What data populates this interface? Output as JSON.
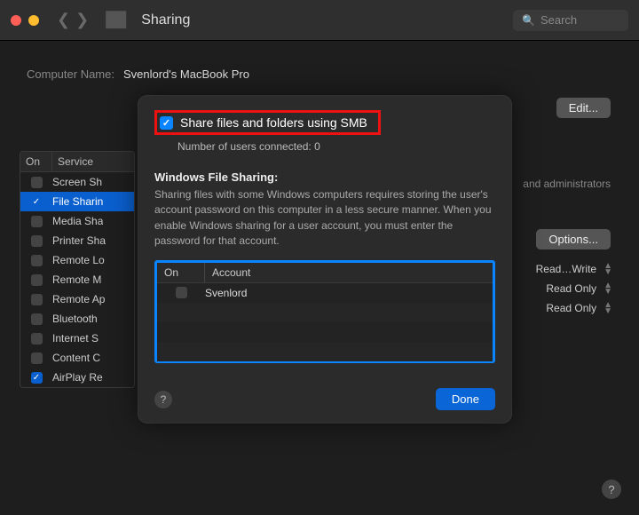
{
  "window": {
    "title": "Sharing",
    "search_placeholder": "Search"
  },
  "main": {
    "computer_name_label": "Computer Name:",
    "computer_name": "Svenlord's MacBook Pro",
    "edit_label": "Edit...",
    "options_label": "Options...",
    "admins_hint": "and administrators"
  },
  "services": {
    "header_on": "On",
    "header_service": "Service",
    "items": [
      {
        "on": false,
        "label": "Screen Sh"
      },
      {
        "on": true,
        "label": "File Sharin"
      },
      {
        "on": false,
        "label": "Media Sha"
      },
      {
        "on": false,
        "label": "Printer Sha"
      },
      {
        "on": false,
        "label": "Remote Lo"
      },
      {
        "on": false,
        "label": "Remote M"
      },
      {
        "on": false,
        "label": "Remote Ap"
      },
      {
        "on": false,
        "label": "Bluetooth"
      },
      {
        "on": false,
        "label": "Internet S"
      },
      {
        "on": false,
        "label": "Content C"
      },
      {
        "on": true,
        "label": "AirPlay Re"
      }
    ]
  },
  "permissions": [
    "Read…Write",
    "Read Only",
    "Read Only"
  ],
  "sheet": {
    "smb_label": "Share files and folders using SMB",
    "connected_text": "Number of users connected: 0",
    "wfs_title": "Windows File Sharing:",
    "wfs_desc": "Sharing files with some Windows computers requires storing the user's account password on this computer in a less secure manner. When you enable Windows sharing for a user account, you must enter the password for that account.",
    "acct_header_on": "On",
    "acct_header_account": "Account",
    "accounts": [
      {
        "on": false,
        "name": "Svenlord"
      }
    ],
    "done_label": "Done"
  }
}
